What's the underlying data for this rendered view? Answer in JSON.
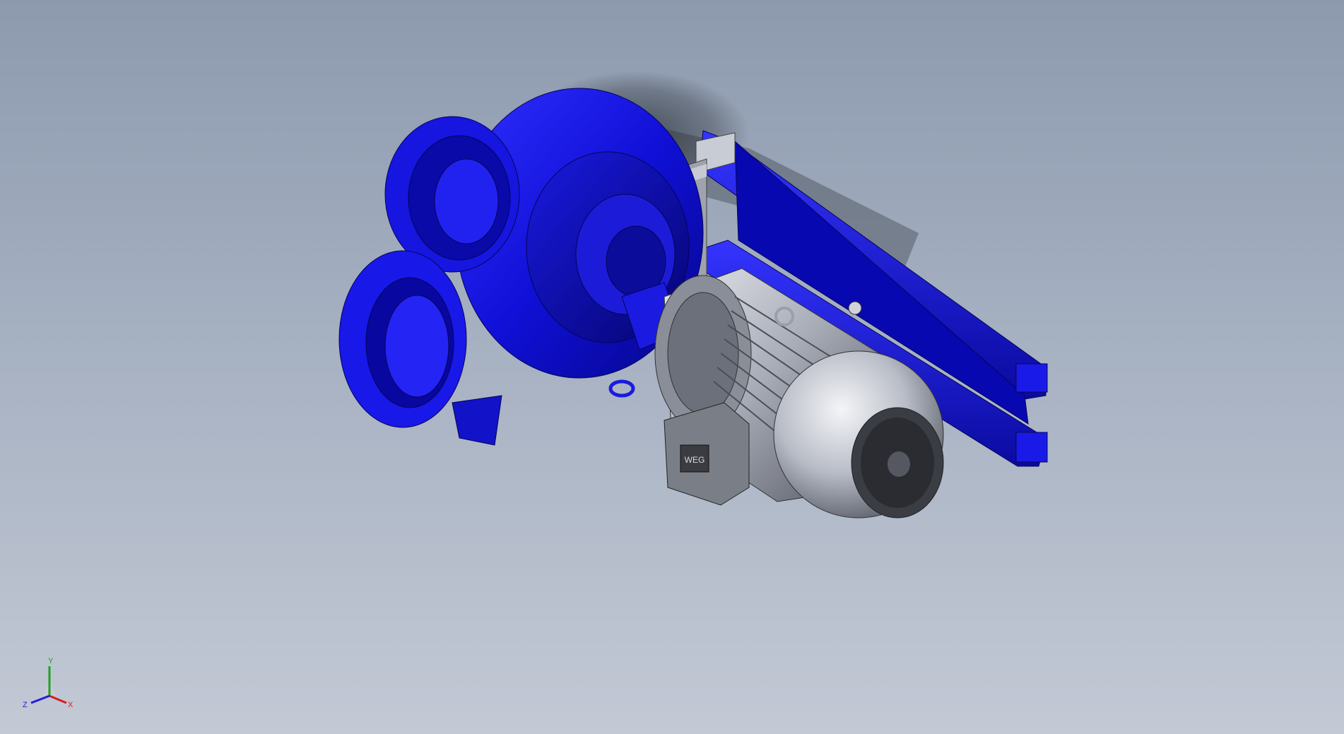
{
  "viewport": {
    "background_top": "#8d9aae",
    "background_bottom": "#c3c9d5"
  },
  "model": {
    "pump_color": "#1010e0",
    "motor_color": "#b4b8c4",
    "nameplate_text": "WEG"
  },
  "triad": {
    "x_label": "X",
    "y_label": "Y",
    "z_label": "Z",
    "x_color": "#d02020",
    "y_color": "#20a020",
    "z_color": "#2020d0"
  }
}
